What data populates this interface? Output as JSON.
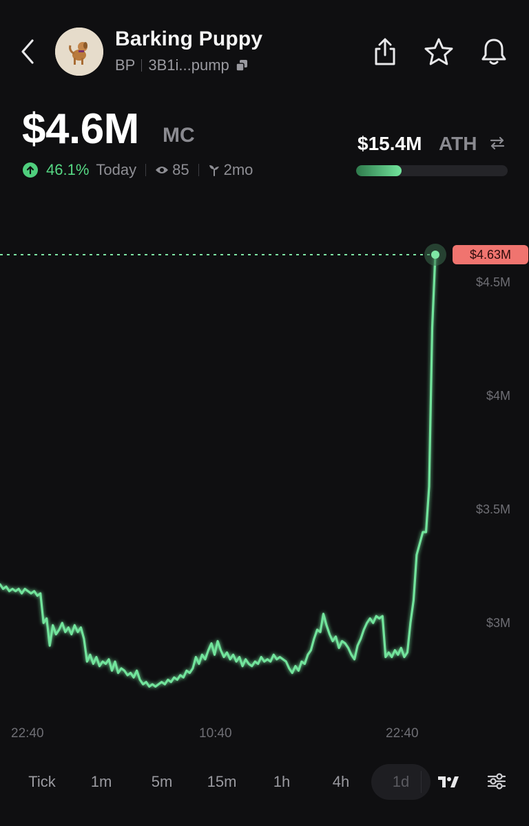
{
  "header": {
    "token_name": "Barking Puppy",
    "ticker": "BP",
    "address": "3B1i...pump",
    "icons": [
      "back-icon",
      "share-icon",
      "star-icon",
      "bell-icon",
      "copy-icon"
    ]
  },
  "market_cap": {
    "value": "$4.6M",
    "unit": "MC",
    "change_pct": "46.1%",
    "change_period": "Today",
    "watchers": "85",
    "age": "2mo"
  },
  "ath": {
    "value": "$15.4M",
    "label": "ATH",
    "progress_fraction": 0.3
  },
  "colors": {
    "background": "#0f0f11",
    "line": "#6ee49a",
    "positive": "#56d884",
    "price_tag": "#f0746f"
  },
  "chart_data": {
    "type": "line",
    "current_price_label": "$4.63M",
    "y_ticks": [
      {
        "value": 4500000,
        "label": "$4.5M"
      },
      {
        "value": 4000000,
        "label": "$4M"
      },
      {
        "value": 3500000,
        "label": "$3.5M"
      },
      {
        "value": 3000000,
        "label": "$3M"
      }
    ],
    "x_ticks": [
      "22:40",
      "10:40",
      "22:40"
    ],
    "ylim": [
      2500000,
      4630000
    ],
    "values": [
      3.17,
      3.15,
      3.16,
      3.14,
      3.15,
      3.14,
      3.15,
      3.13,
      3.15,
      3.14,
      3.13,
      3.14,
      3.12,
      3.13,
      3.0,
      3.02,
      2.9,
      2.99,
      2.95,
      2.97,
      3.0,
      2.96,
      2.98,
      2.95,
      2.99,
      2.96,
      2.98,
      2.93,
      2.83,
      2.86,
      2.82,
      2.85,
      2.81,
      2.83,
      2.82,
      2.84,
      2.79,
      2.83,
      2.78,
      2.8,
      2.79,
      2.77,
      2.78,
      2.76,
      2.79,
      2.75,
      2.73,
      2.74,
      2.72,
      2.73,
      2.72,
      2.73,
      2.74,
      2.73,
      2.75,
      2.74,
      2.76,
      2.75,
      2.77,
      2.76,
      2.79,
      2.78,
      2.8,
      2.85,
      2.82,
      2.86,
      2.84,
      2.88,
      2.91,
      2.86,
      2.92,
      2.88,
      2.85,
      2.87,
      2.84,
      2.86,
      2.83,
      2.85,
      2.81,
      2.84,
      2.82,
      2.81,
      2.83,
      2.82,
      2.85,
      2.83,
      2.84,
      2.83,
      2.86,
      2.84,
      2.85,
      2.84,
      2.83,
      2.8,
      2.78,
      2.81,
      2.79,
      2.83,
      2.82,
      2.86,
      2.88,
      2.93,
      2.97,
      2.96,
      3.04,
      2.99,
      2.95,
      2.92,
      2.94,
      2.89,
      2.92,
      2.91,
      2.89,
      2.86,
      2.84,
      2.9,
      2.93,
      2.97,
      3.0,
      3.02,
      3.0,
      3.03,
      3.02,
      3.03,
      2.85,
      2.87,
      2.85,
      2.88,
      2.86,
      2.89,
      2.85,
      2.87,
      3.0,
      3.1,
      3.3,
      3.35,
      3.4,
      3.4,
      3.6,
      4.3,
      4.63
    ]
  },
  "timeframes": [
    {
      "label": "Tick",
      "active": false
    },
    {
      "label": "1m",
      "active": false
    },
    {
      "label": "5m",
      "active": false
    },
    {
      "label": "15m",
      "active": false
    },
    {
      "label": "1h",
      "active": false
    },
    {
      "label": "4h",
      "active": false
    },
    {
      "label": "1d",
      "active": true
    }
  ]
}
